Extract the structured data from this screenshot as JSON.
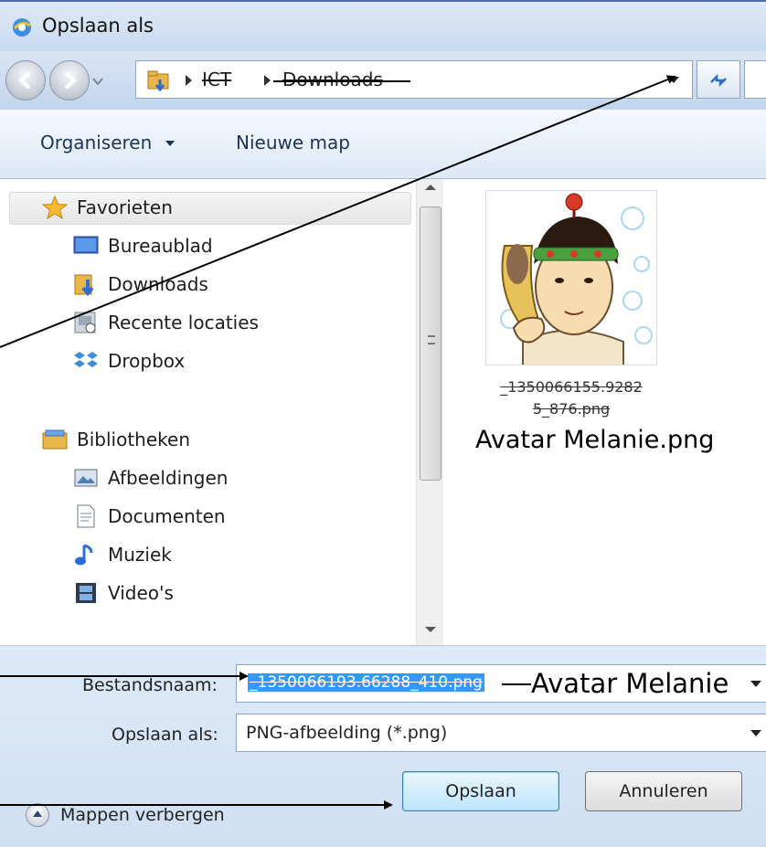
{
  "window": {
    "title": "Opslaan als"
  },
  "address": {
    "crumbs": [
      "ICT",
      "Downloads"
    ]
  },
  "toolbar": {
    "organize_label": "Organiseren",
    "new_folder_label": "Nieuwe map"
  },
  "navigation": {
    "favorites": {
      "label": "Favorieten",
      "items": [
        "Bureaublad",
        "Downloads",
        "Recente locaties",
        "Dropbox"
      ]
    },
    "libraries": {
      "label": "Bibliotheken",
      "items": [
        "Afbeeldingen",
        "Documenten",
        "Muziek",
        "Video's"
      ]
    }
  },
  "file": {
    "original_name_line1": "_1350066155.9282",
    "original_name_line2": "5_876.png",
    "new_name": "Avatar Melanie.png"
  },
  "form": {
    "filename_label": "Bestandsnaam:",
    "filename_selected": "_1350066193.66288_410.png",
    "filename_new": "Avatar Melanie",
    "savetype_label": "Opslaan als:",
    "savetype_value": "PNG-afbeelding (*.png)"
  },
  "footer": {
    "hide_folders_label": "Mappen verbergen",
    "save_label": "Opslaan",
    "cancel_label": "Annuleren"
  },
  "colors": {
    "selection": "#3399ff",
    "titlebar": "#c9dbf0",
    "panel": "#d0e0f2"
  }
}
